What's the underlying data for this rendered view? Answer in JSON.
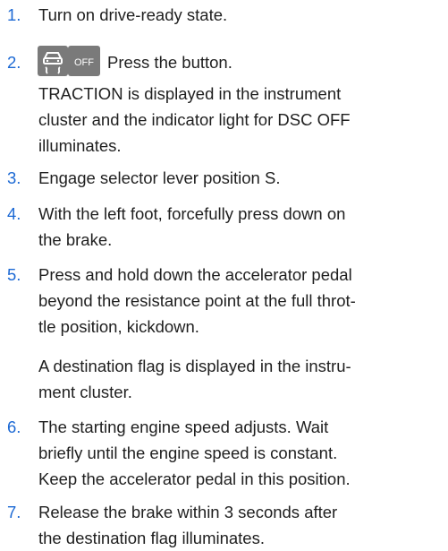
{
  "steps": [
    {
      "number": "1.",
      "lines": [
        "Turn on drive-ready state."
      ]
    },
    {
      "number": "2.",
      "button_label": "Press the button.",
      "icon": "traction-dsc-off-icon",
      "icon_text": "OFF",
      "note_lines": [
        "TRACTION is displayed in the instrument",
        "cluster and the indicator light for DSC OFF",
        "illuminates."
      ]
    },
    {
      "number": "3.",
      "lines": [
        "Engage selector lever position S."
      ]
    },
    {
      "number": "4.",
      "lines": [
        "With the left foot, forcefully press down on",
        "the brake."
      ]
    },
    {
      "number": "5.",
      "lines": [
        "Press and hold down the accelerator pedal",
        "beyond the resistance point at the full throt-",
        "tle position, kickdown."
      ],
      "note_lines": [
        "A destination flag is displayed in the instru-",
        "ment cluster."
      ]
    },
    {
      "number": "6.",
      "lines": [
        "The starting engine speed adjusts. Wait",
        "briefly until the engine speed is constant.",
        "Keep the accelerator pedal in this position."
      ]
    },
    {
      "number": "7.",
      "lines": [
        "Release the brake within 3 seconds after",
        "the destination flag illuminates."
      ]
    }
  ],
  "colors": {
    "step_number": "#1c69d4",
    "text": "#1f1f1f",
    "icon_bg": "#7a7a7a"
  }
}
